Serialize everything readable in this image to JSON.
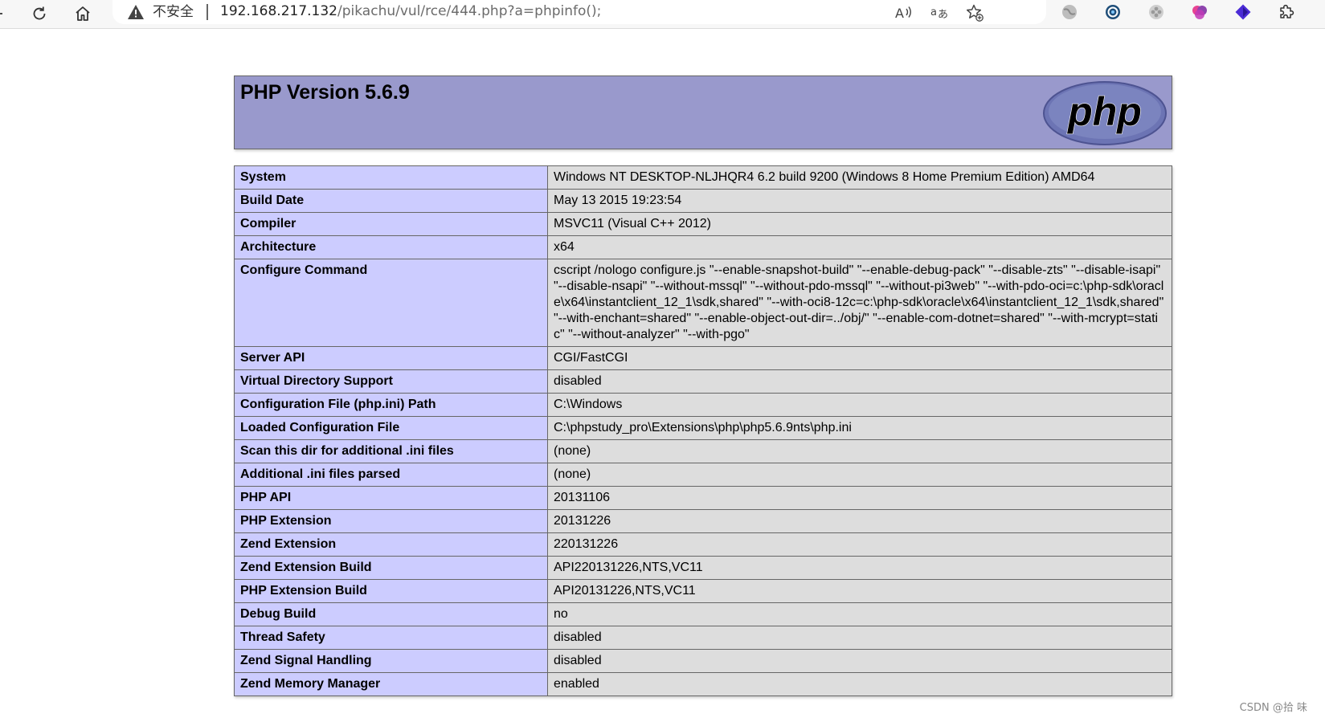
{
  "browser": {
    "security_label": "不安全",
    "url_host": "192.168.217.132",
    "url_path": "/pikachu/vul/rce/444.php?a=phpinfo();"
  },
  "php": {
    "title": "PHP Version 5.6.9",
    "logo_text": "php",
    "rows": [
      {
        "key": "System",
        "value": "Windows NT DESKTOP-NLJHQR4 6.2 build 9200 (Windows 8 Home Premium Edition) AMD64"
      },
      {
        "key": "Build Date",
        "value": "May 13 2015 19:23:54"
      },
      {
        "key": "Compiler",
        "value": "MSVC11 (Visual C++ 2012)"
      },
      {
        "key": "Architecture",
        "value": "x64"
      },
      {
        "key": "Configure Command",
        "value": "cscript /nologo configure.js \"--enable-snapshot-build\" \"--enable-debug-pack\" \"--disable-zts\" \"--disable-isapi\" \"--disable-nsapi\" \"--without-mssql\" \"--without-pdo-mssql\" \"--without-pi3web\" \"--with-pdo-oci=c:\\php-sdk\\oracle\\x64\\instantclient_12_1\\sdk,shared\" \"--with-oci8-12c=c:\\php-sdk\\oracle\\x64\\instantclient_12_1\\sdk,shared\" \"--with-enchant=shared\" \"--enable-object-out-dir=../obj/\" \"--enable-com-dotnet=shared\" \"--with-mcrypt=static\" \"--without-analyzer\" \"--with-pgo\""
      },
      {
        "key": "Server API",
        "value": "CGI/FastCGI"
      },
      {
        "key": "Virtual Directory Support",
        "value": "disabled"
      },
      {
        "key": "Configuration File (php.ini) Path",
        "value": "C:\\Windows"
      },
      {
        "key": "Loaded Configuration File",
        "value": "C:\\phpstudy_pro\\Extensions\\php\\php5.6.9nts\\php.ini"
      },
      {
        "key": "Scan this dir for additional .ini files",
        "value": "(none)"
      },
      {
        "key": "Additional .ini files parsed",
        "value": "(none)"
      },
      {
        "key": "PHP API",
        "value": "20131106"
      },
      {
        "key": "PHP Extension",
        "value": "20131226"
      },
      {
        "key": "Zend Extension",
        "value": "220131226"
      },
      {
        "key": "Zend Extension Build",
        "value": "API220131226,NTS,VC11"
      },
      {
        "key": "PHP Extension Build",
        "value": "API20131226,NTS,VC11"
      },
      {
        "key": "Debug Build",
        "value": "no"
      },
      {
        "key": "Thread Safety",
        "value": "disabled"
      },
      {
        "key": "Zend Signal Handling",
        "value": "disabled"
      },
      {
        "key": "Zend Memory Manager",
        "value": "enabled"
      }
    ]
  },
  "watermark": "CSDN @拾 味"
}
